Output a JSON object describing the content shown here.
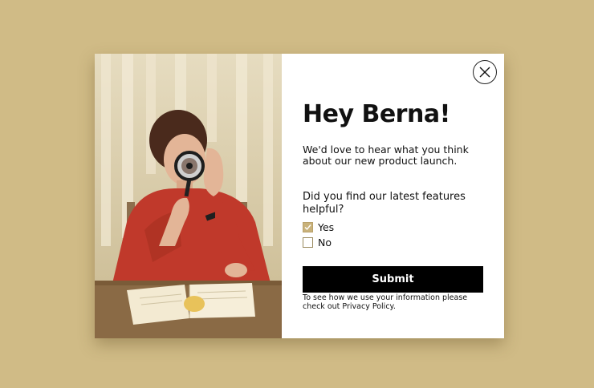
{
  "popup": {
    "heading": "Hey Berna!",
    "intro": "We'd love to hear what you think about our new product launch.",
    "question": "Did you find our latest features helpful?",
    "options": [
      {
        "label": "Yes",
        "checked": true
      },
      {
        "label": "No",
        "checked": false
      }
    ],
    "submit_label": "Submit",
    "privacy_prefix": "To see how we use your information please check out ",
    "privacy_link": "Privacy Policy",
    "privacy_suffix": "."
  },
  "icons": {
    "close": "close-icon",
    "check": "check-icon"
  },
  "colors": {
    "page_background": "#d0bb86",
    "card_background": "#ffffff",
    "button_background": "#000000",
    "button_text": "#ffffff",
    "checkbox_checked": "#c9b27a"
  }
}
